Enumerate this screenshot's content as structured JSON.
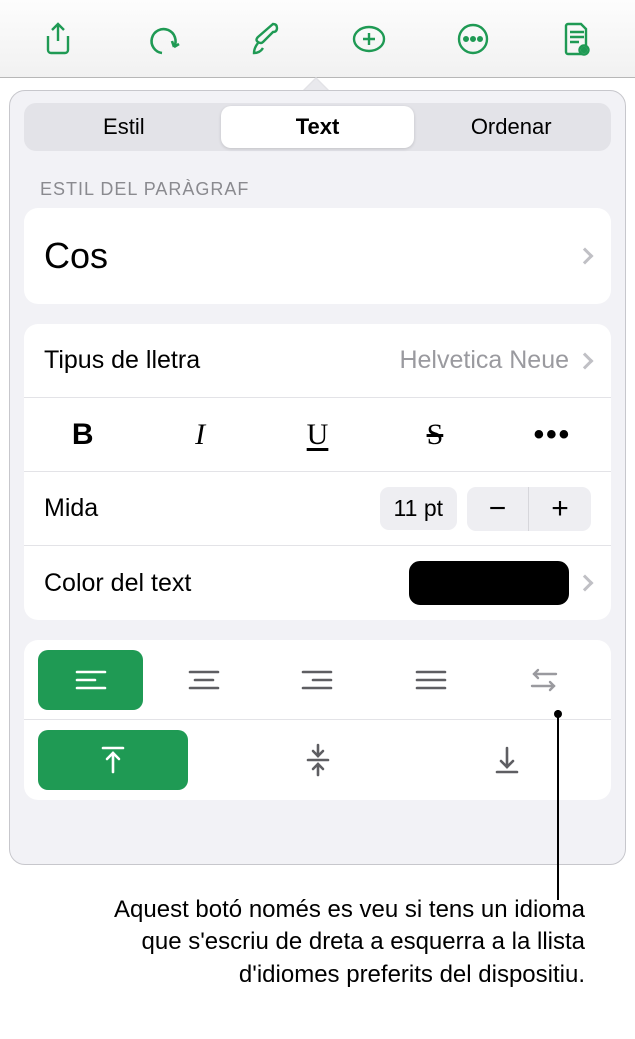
{
  "toolbar": {
    "icons": [
      "share-icon",
      "undo-icon",
      "format-brush-icon",
      "insert-icon",
      "more-icon",
      "document-view-icon"
    ],
    "active_index": 2
  },
  "tabs": {
    "items": [
      "Estil",
      "Text",
      "Ordenar"
    ],
    "selected_index": 1
  },
  "paragraph_style": {
    "section_label": "ESTIL DEL PARÀGRAF",
    "value": "Cos"
  },
  "font": {
    "label": "Tipus de lletra",
    "value": "Helvetica Neue"
  },
  "style_buttons": {
    "bold": "B",
    "italic": "I",
    "underline": "U",
    "strike": "S",
    "more": "•••"
  },
  "size": {
    "label": "Mida",
    "value": "11 pt",
    "minus": "−",
    "plus": "+"
  },
  "text_color": {
    "label": "Color del text",
    "value": "#000000"
  },
  "alignment": {
    "horizontal": [
      "align-left",
      "align-center",
      "align-right",
      "align-justify",
      "text-direction-rtl"
    ],
    "horizontal_selected": 0,
    "vertical": [
      "valign-top",
      "valign-middle",
      "valign-bottom"
    ],
    "vertical_selected": 0
  },
  "caption": "Aquest botó només es veu si tens un idioma que s'escriu de dreta a esquerra a la llista d'idiomes preferits del dispositiu."
}
